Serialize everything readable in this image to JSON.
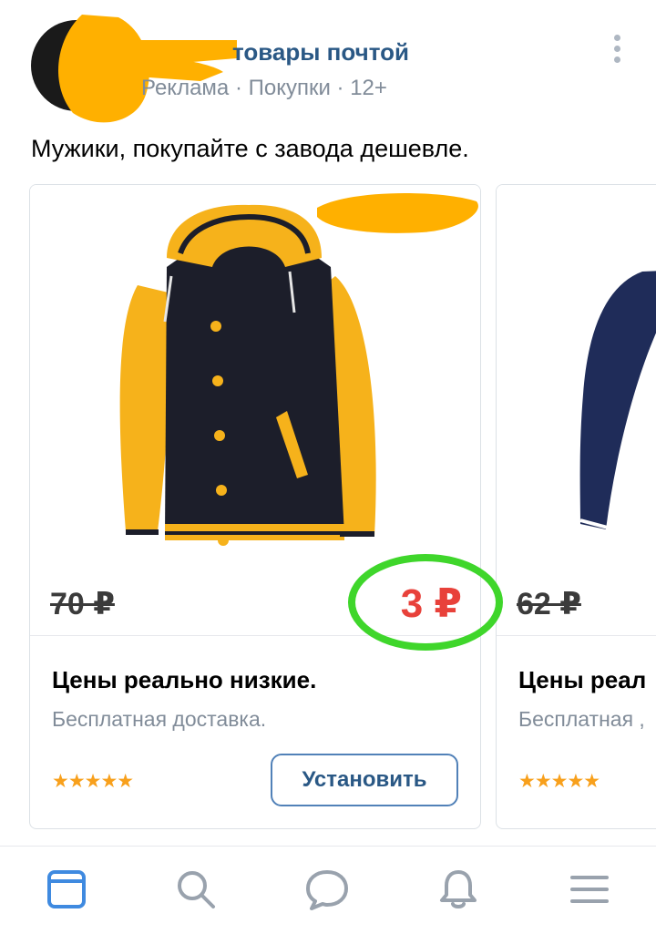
{
  "post": {
    "author": "товары почтой",
    "meta": "Реклама · Покупки · 12+",
    "text": "Мужики, покупайте с завода дешевле."
  },
  "cards": [
    {
      "old_price": "70 ₽",
      "new_price": "3 ₽",
      "title": "Цены реально низкие.",
      "subtitle": "Бесплатная доставка.",
      "stars": "★★★★★",
      "button": "Установить"
    },
    {
      "old_price": "62 ₽",
      "title": "Цены реал",
      "subtitle": "Бесплатная ,",
      "stars": "★★★★★"
    }
  ],
  "tabbar": {
    "items": [
      {
        "icon": "news-feed-icon",
        "active": true
      },
      {
        "icon": "search-icon"
      },
      {
        "icon": "messages-icon"
      },
      {
        "icon": "notifications-bell-icon"
      },
      {
        "icon": "menu-icon"
      }
    ]
  },
  "colors": {
    "link": "#2a5885",
    "muted": "#818c99",
    "price_red": "#e8413a",
    "star": "#f8a01c",
    "button_border": "#5181b8",
    "highlight": "#3fd62b",
    "scribble": "#ffb000",
    "tab_active": "#3f8ae0",
    "tab_inactive": "#99a2ad"
  },
  "rating": 4.5
}
